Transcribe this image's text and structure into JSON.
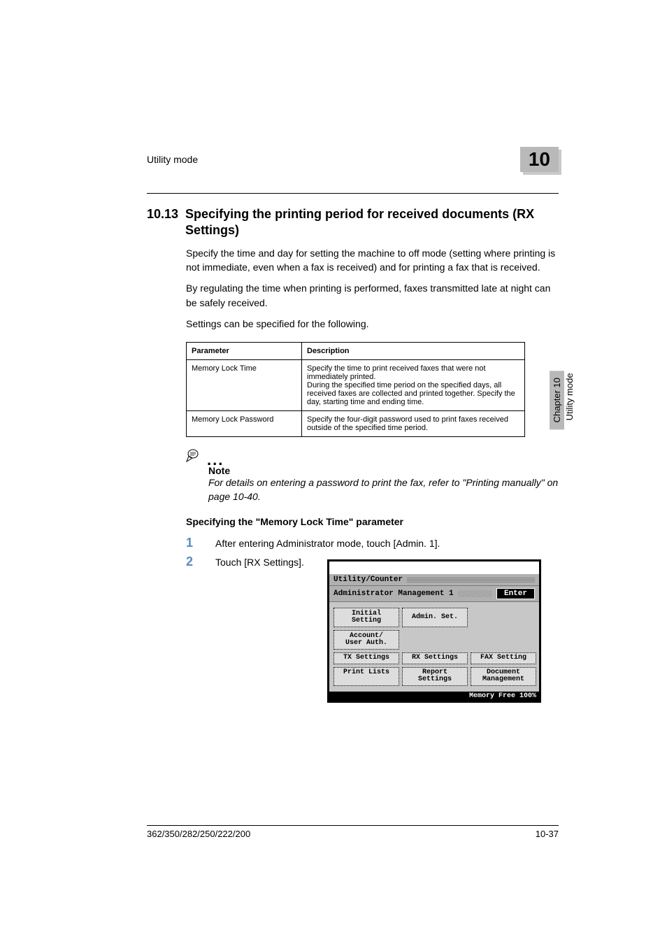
{
  "running_head": {
    "left": "Utility mode",
    "chapter_number": "10"
  },
  "section": {
    "number": "10.13",
    "title": "Specifying the printing period for received documents (RX Settings)"
  },
  "paragraphs": {
    "p1": "Specify the time and day for setting the machine to off mode (setting where printing is not immediate, even when a fax is received) and for printing a fax that is received.",
    "p2": "By regulating the time when printing is performed, faxes transmitted late at night can be safely received.",
    "p3": "Settings can be specified for the following."
  },
  "table": {
    "headers": {
      "c1": "Parameter",
      "c2": "Description"
    },
    "rows": [
      {
        "parameter": "Memory Lock Time",
        "description": "Specify the time to print received faxes that were not immediately printed.\nDuring the specified time period on the specified days, all received faxes are collected and printed together. Specify the day, starting time and ending time."
      },
      {
        "parameter": "Memory Lock Password",
        "description": "Specify the four-digit password used to print faxes received outside of the specified time period."
      }
    ]
  },
  "note": {
    "label": "Note",
    "body": "For details on entering a password to print the fax, refer to \"Printing manually\" on page 10-40."
  },
  "subhead": "Specifying the \"Memory Lock Time\" parameter",
  "steps": {
    "s1": {
      "n": "1",
      "txt": "After entering Administrator mode, touch [Admin. 1]."
    },
    "s2": {
      "n": "2",
      "txt": "Touch [RX Settings]."
    }
  },
  "screenshot": {
    "title": "Utility/Counter",
    "subtitle": "Administrator Management 1",
    "enter": "Enter",
    "buttons": {
      "initial": "Initial\nSetting",
      "admin": "Admin. Set.",
      "account": "Account/\nUser Auth.",
      "tx": "TX Settings",
      "rx": "RX Settings",
      "fax": "FAX Setting",
      "print": "Print Lists",
      "report": "Report\nSettings",
      "doc": "Document\nManagement"
    },
    "memory": "Memory Free 100%"
  },
  "side_tab": {
    "chapter": "Chapter 10",
    "label": "Utility mode"
  },
  "footer": {
    "left": "362/350/282/250/222/200",
    "right": "10-37"
  }
}
